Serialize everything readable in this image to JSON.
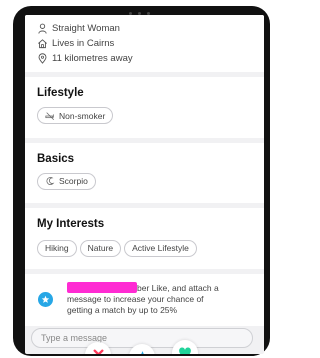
{
  "profile": {
    "orientation": "Straight Woman",
    "location": "Lives in Cairns",
    "distance": "11 kilometres away"
  },
  "lifestyle": {
    "title": "Lifestyle",
    "chip": "Non-smoker"
  },
  "basics": {
    "title": "Basics",
    "chip": "Scorpio"
  },
  "interests": {
    "title": "My Interests",
    "items": [
      "Hiking",
      "Nature",
      "Active Lifestyle"
    ]
  },
  "superlike": {
    "text_line1_tail": "ber Like, and attach a",
    "text_line2": "message to increase your chance of",
    "text_line3": "getting a match by up to 25%"
  },
  "message": {
    "placeholder": "Type a message"
  },
  "colors": {
    "accent_pink": "#ff2bd3",
    "superlike_blue": "#27a7e6",
    "nope_red": "#ff3b5c",
    "like_green": "#1fd39a"
  }
}
